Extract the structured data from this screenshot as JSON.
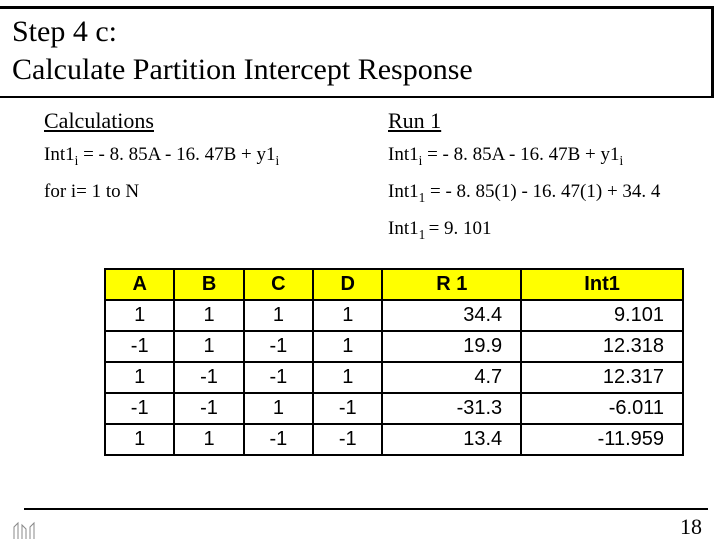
{
  "title": {
    "line1": "Step 4 c:",
    "line2": "Calculate Partition Intercept Response"
  },
  "left": {
    "heading": "Calculations",
    "eq1_pre": "Int1",
    "eq1_sub": "i",
    "eq1_mid": " = - 8. 85A - 16. 47B + y1",
    "eq1_sub2": "i",
    "eq2": "for i= 1 to N"
  },
  "right": {
    "heading": "Run 1",
    "eq1_pre": "Int1",
    "eq1_sub": "i",
    "eq1_mid": " = - 8. 85A - 16. 47B + y1",
    "eq1_sub2": "i",
    "eq2_pre": "Int1",
    "eq2_sub": "1",
    "eq2_rest": " = - 8. 85(1) - 16. 47(1) + 34. 4",
    "eq3_pre": "Int1",
    "eq3_sub": "1 ",
    "eq3_rest": "= 9. 101"
  },
  "chart_data": {
    "type": "table",
    "columns": [
      "A",
      "B",
      "C",
      "D",
      "R1",
      "Int1"
    ],
    "rows": [
      [
        1,
        1,
        1,
        1,
        34.4,
        9.101
      ],
      [
        -1,
        1,
        -1,
        1,
        19.9,
        12.318
      ],
      [
        1,
        -1,
        -1,
        1,
        4.7,
        12.317
      ],
      [
        -1,
        -1,
        1,
        -1,
        -31.3,
        -6.011
      ],
      [
        1,
        1,
        -1,
        -1,
        13.4,
        -11.959
      ]
    ]
  },
  "table_headers": {
    "A": "A",
    "B": "B",
    "C": "C",
    "D": "D",
    "R1": "R 1",
    "Int1": "Int1"
  },
  "page_number": "18"
}
